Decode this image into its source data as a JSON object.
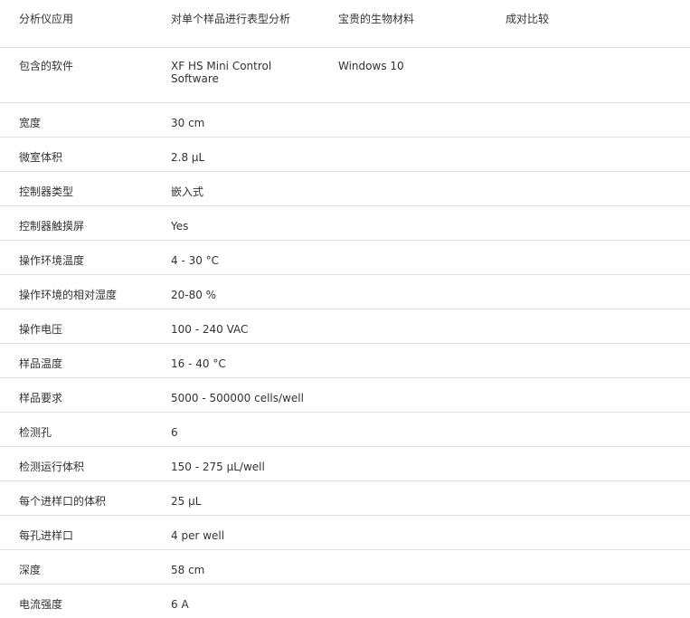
{
  "header": {
    "col1": "分析仪应用",
    "col2": "对单个样品进行表型分析",
    "col3": "宝贵的生物材料",
    "col4": "成对比较"
  },
  "software_row": {
    "label": "包含的软件",
    "value1_line1": "XF HS Mini Control",
    "value1_line2": "Software",
    "value2": "Windows 10"
  },
  "rows": [
    {
      "label": "宽度",
      "value": "30 cm"
    },
    {
      "label": "微室体积",
      "value": "2.8 µL"
    },
    {
      "label": "控制器类型",
      "value": "嵌入式"
    },
    {
      "label": "控制器触摸屏",
      "value": "Yes"
    },
    {
      "label": "操作环境温度",
      "value": "4 - 30 °C"
    },
    {
      "label": "操作环境的相对湿度",
      "value": "20-80 %"
    },
    {
      "label": "操作电压",
      "value": "100 - 240 VAC"
    },
    {
      "label": "样品温度",
      "value": "16 - 40 °C"
    },
    {
      "label": "样品要求",
      "value": "5000 - 500000 cells/well"
    },
    {
      "label": "检测孔",
      "value": "6"
    },
    {
      "label": "检测运行体积",
      "value": "150 - 275 µL/well"
    },
    {
      "label": "每个进样口的体积",
      "value": "25 µL"
    },
    {
      "label": "每孔进样口",
      "value": "4 per well"
    },
    {
      "label": "深度",
      "value": "58 cm"
    },
    {
      "label": "电流强度",
      "value": "6 A"
    }
  ]
}
